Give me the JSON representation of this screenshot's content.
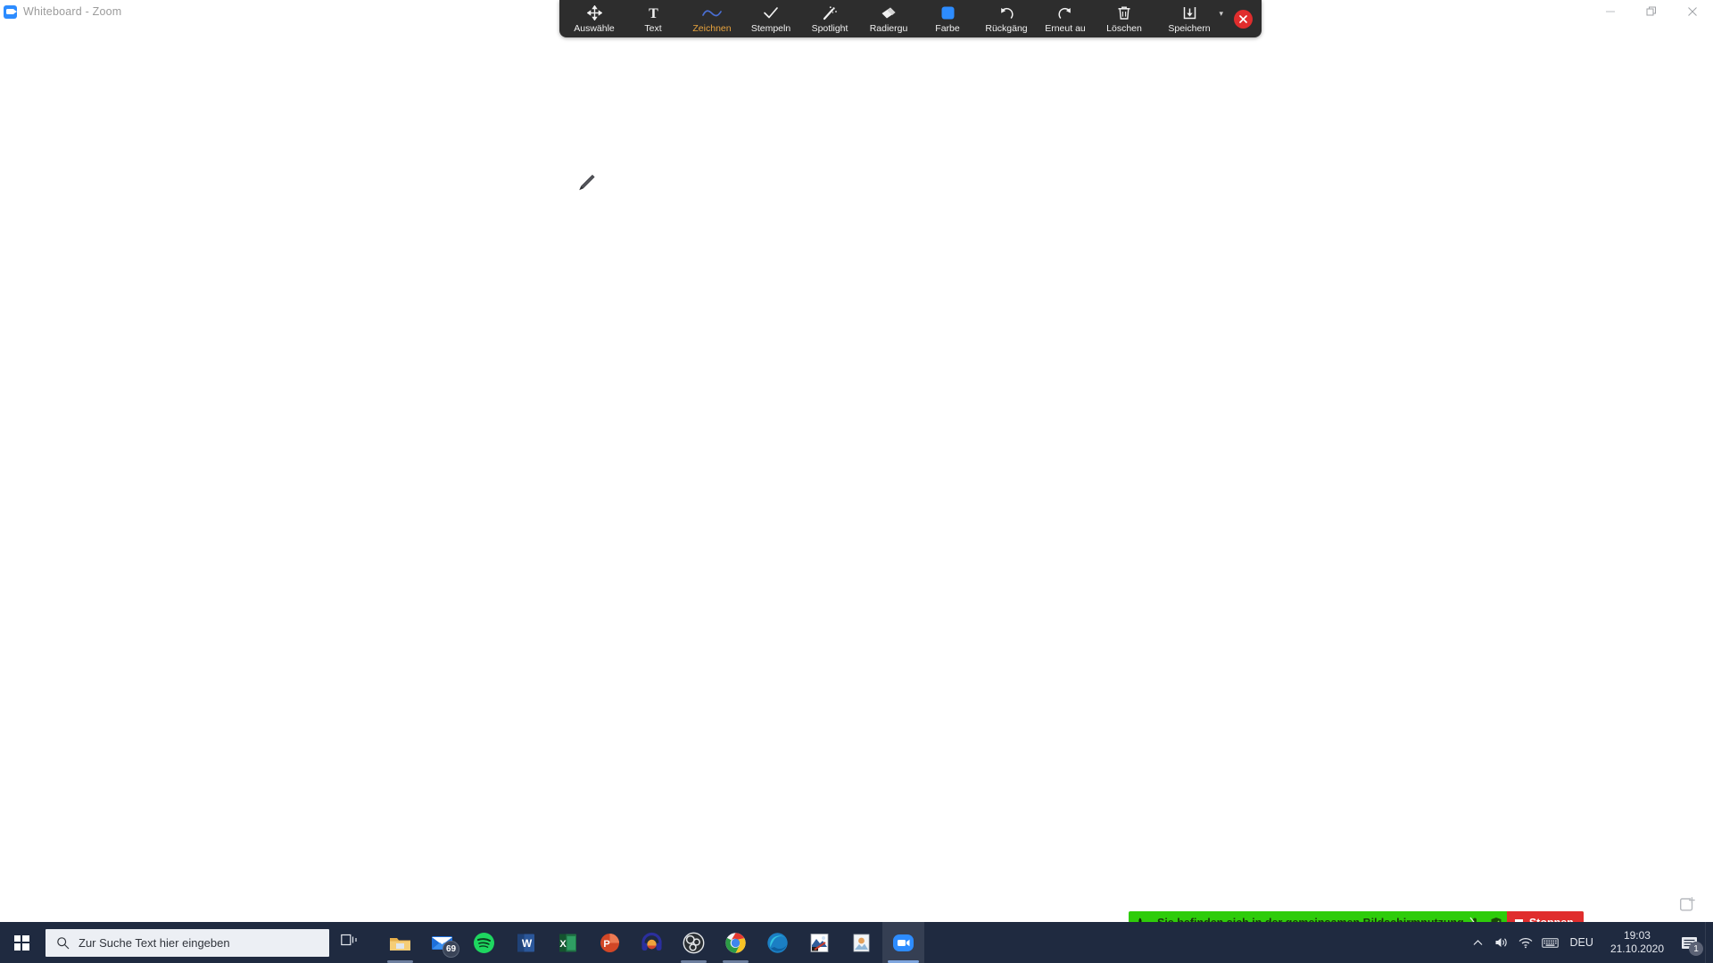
{
  "window": {
    "title": "Whiteboard - Zoom",
    "logo_icon": "zoom-camera-icon",
    "controls": [
      {
        "name": "minimize-button",
        "icon": "minimize-icon"
      },
      {
        "name": "restore-button",
        "icon": "restore-icon"
      },
      {
        "name": "close-button",
        "icon": "close-icon"
      }
    ]
  },
  "annotation_toolbar": {
    "background": "#2d2d2d",
    "active_color": "#e8a33d",
    "tools": [
      {
        "label": "Auswähle",
        "icon": "move-arrows-icon",
        "active": false
      },
      {
        "label": "Text",
        "icon": "text-t-icon",
        "active": false
      },
      {
        "label": "Zeichnen",
        "icon": "squiggle-line-icon",
        "active": true
      },
      {
        "label": "Stempeln",
        "icon": "checkmark-stamp-icon",
        "active": false
      },
      {
        "label": "Spotlight",
        "icon": "magic-wand-icon",
        "active": false
      },
      {
        "label": "Radiergu",
        "icon": "eraser-icon",
        "active": false
      },
      {
        "label": "Farbe",
        "icon": "color-swatch-icon",
        "active": false,
        "swatch": "#2d8cff"
      },
      {
        "label": "Rückgäng",
        "icon": "undo-arrow-icon",
        "active": false
      },
      {
        "label": "Erneut au",
        "icon": "redo-arrow-icon",
        "active": false
      },
      {
        "label": "Löschen",
        "icon": "trash-can-icon",
        "active": false
      },
      {
        "label": "Speichern",
        "icon": "save-download-icon",
        "active": false,
        "has_chevron": true
      }
    ],
    "close_button": {
      "name": "close-annotation-toolbar",
      "icon": "close-x-icon",
      "color": "#e02d2d"
    }
  },
  "canvas": {
    "cursor_icon": "pencil-cursor",
    "new_note_icon": "new-note-icon"
  },
  "share_banner": {
    "text": "Sie befinden sich in der gemeinsamen Bildschirmnutzung",
    "background": "#2ecc0a",
    "phone_icon": "phone-handset-icon",
    "mic_icon": "microphone-muted-icon",
    "shield_icon": "shield-check-icon",
    "stop_button": {
      "label": "Stoppen",
      "icon": "stop-square-icon",
      "color": "#e02d2d"
    }
  },
  "taskbar": {
    "background": "#1f2a40",
    "start_icon": "windows-logo-icon",
    "search": {
      "placeholder": "Zur Suche Text hier eingeben",
      "icon": "search-icon"
    },
    "taskview_icon": "task-view-icon",
    "apps": [
      {
        "name": "file-explorer",
        "icon": "folder-icon",
        "running": true,
        "badge": null
      },
      {
        "name": "mail",
        "icon": "mail-envelope-icon",
        "running": false,
        "badge": "69"
      },
      {
        "name": "spotify",
        "icon": "spotify-icon",
        "running": false,
        "badge": null
      },
      {
        "name": "word",
        "icon": "word-icon",
        "running": false,
        "badge": null
      },
      {
        "name": "excel",
        "icon": "excel-icon",
        "running": false,
        "badge": null
      },
      {
        "name": "powerpoint",
        "icon": "powerpoint-icon",
        "running": false,
        "badge": null
      },
      {
        "name": "headphones-app",
        "icon": "headphones-icon",
        "running": false,
        "badge": null
      },
      {
        "name": "obs-studio",
        "icon": "obs-icon",
        "running": true,
        "badge": null
      },
      {
        "name": "google-chrome",
        "icon": "chrome-icon",
        "running": true,
        "badge": null
      },
      {
        "name": "microsoft-edge",
        "icon": "edge-icon",
        "running": false,
        "badge": null
      },
      {
        "name": "image-editor",
        "icon": "image-editor-icon",
        "running": false,
        "badge": null
      },
      {
        "name": "photos",
        "icon": "photos-icon",
        "running": false,
        "badge": null
      },
      {
        "name": "zoom-meeting",
        "icon": "zoom-camera-icon",
        "running": true,
        "badge": null,
        "active": true
      }
    ],
    "tray": {
      "chevron_icon": "chevron-up-icon",
      "volume_icon": "speaker-volume-icon",
      "network_icon": "wifi-icon",
      "keyboard_icon": "keyboard-icon",
      "language": "DEU",
      "time": "19:03",
      "date": "21.10.2020",
      "notification_icon": "action-center-icon",
      "notification_count": "1"
    }
  }
}
